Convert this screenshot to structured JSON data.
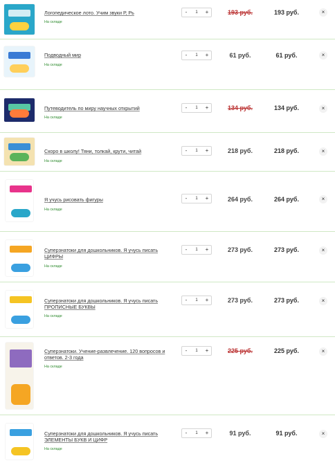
{
  "cart": {
    "items": [
      {
        "title": "Логопедическое лото. Учим звуки Р, Рь",
        "stock": "На складе",
        "qty": "1",
        "minus": "-",
        "plus": "+",
        "price": "193 руб.",
        "total": "193 руб.",
        "discounted": true,
        "remove": "×",
        "cover_colors": [
          "#2aa7c9",
          "#ffd23f"
        ]
      },
      {
        "title": "Подводный мир",
        "stock": "На складе",
        "qty": "1",
        "minus": "-",
        "plus": "+",
        "price": "61 руб.",
        "total": "61 руб.",
        "discounted": false,
        "remove": "×",
        "cover_colors": [
          "#e8f4fb",
          "#3a7bd5"
        ]
      },
      {
        "title": "Путеводитель по миру научных открытий",
        "stock": "На складе",
        "qty": "1",
        "minus": "-",
        "plus": "+",
        "price": "134 руб.",
        "total": "134 руб.",
        "discounted": true,
        "remove": "×",
        "cover_colors": [
          "#1d2b6b",
          "#58c7a4"
        ]
      },
      {
        "title": "Скоро в школу! Тяни, толкай, крути, читай",
        "stock": "На складе",
        "qty": "1",
        "minus": "-",
        "plus": "+",
        "price": "218 руб.",
        "total": "218 руб.",
        "discounted": false,
        "remove": "×",
        "cover_colors": [
          "#f4e2b0",
          "#3a8fd6"
        ]
      },
      {
        "title": "Я учусь рисовать фигуры",
        "stock": "На складе",
        "qty": "1",
        "minus": "-",
        "plus": "+",
        "price": "264 руб.",
        "total": "264 руб.",
        "discounted": false,
        "remove": "×",
        "cover_colors": [
          "#ffffff",
          "#e8338b"
        ]
      },
      {
        "title": "Суперзнатоки для дошкольников. Я учусь писать ЦИФРЫ",
        "stock": "На складе",
        "qty": "1",
        "minus": "-",
        "plus": "+",
        "price": "273 руб.",
        "total": "273 руб.",
        "discounted": false,
        "remove": "×",
        "cover_colors": [
          "#ffffff",
          "#f5a623"
        ]
      },
      {
        "title": "Суперзнатоки для дошкольников. Я учусь писать ПРОПИСНЫЕ БУКВЫ",
        "stock": "На складе",
        "qty": "1",
        "minus": "-",
        "plus": "+",
        "price": "273 руб.",
        "total": "273 руб.",
        "discounted": false,
        "remove": "×",
        "cover_colors": [
          "#ffffff",
          "#f5c423"
        ]
      },
      {
        "title": "Суперзнатоки. Учение-развлечение. 120 вопросов и ответов. 2-3 года",
        "stock": "На складе",
        "qty": "1",
        "minus": "-",
        "plus": "+",
        "price": "225 руб.",
        "total": "225 руб.",
        "discounted": true,
        "remove": "×",
        "cover_colors": [
          "#f7f3ea",
          "#8e6bbf"
        ]
      },
      {
        "title": "Суперзнатоки для дошкольников. Я учусь писать ЭЛЕМЕНТЫ БУКВ И ЦИФР",
        "stock": "На складе",
        "qty": "1",
        "minus": "-",
        "plus": "+",
        "price": "91 руб.",
        "total": "91 руб.",
        "discounted": false,
        "remove": "×",
        "cover_colors": [
          "#ffffff",
          "#3aa0e0"
        ]
      }
    ]
  }
}
